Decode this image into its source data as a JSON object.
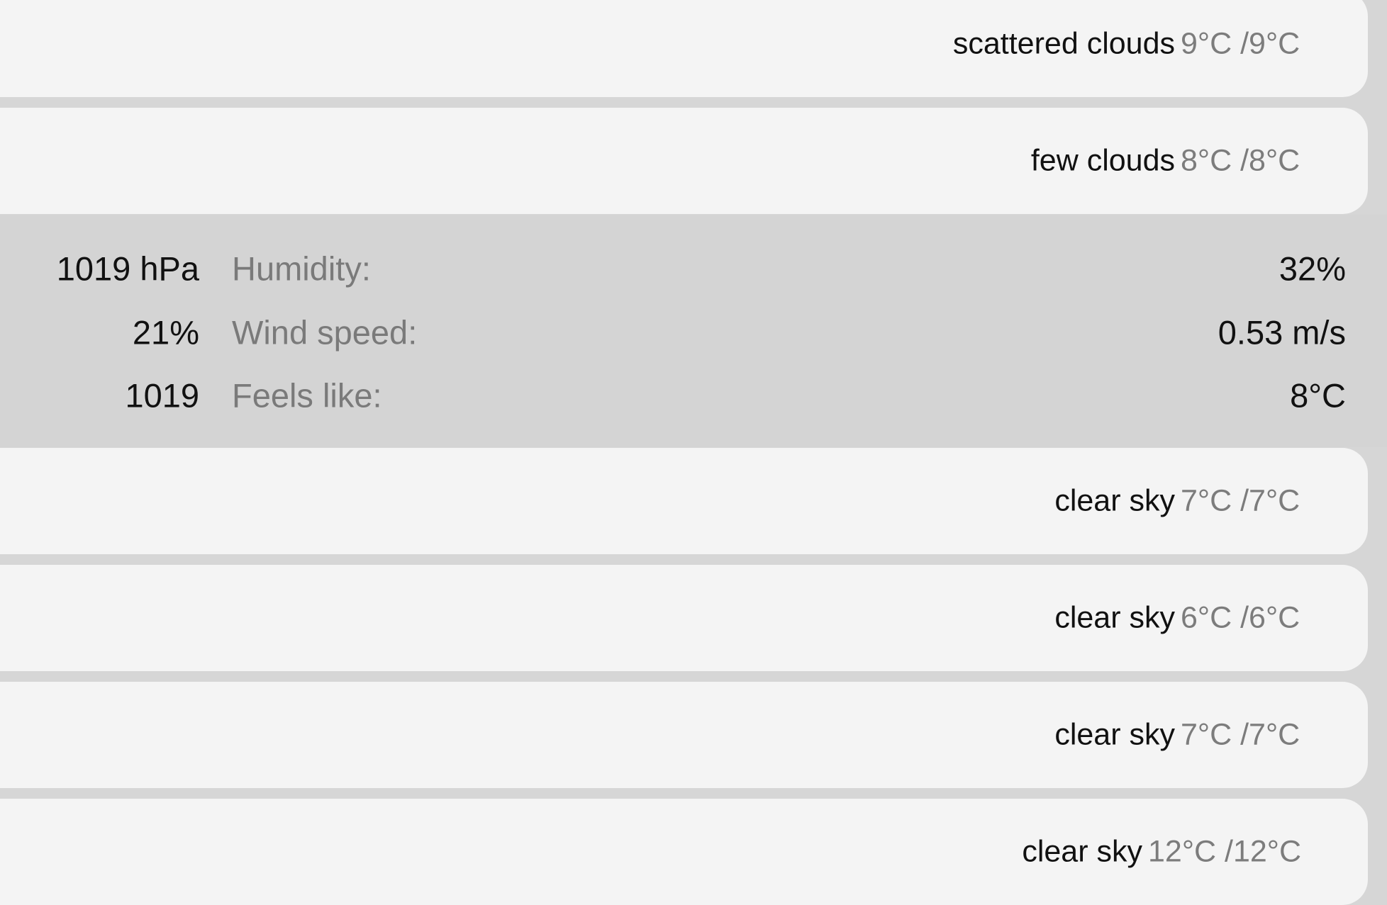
{
  "forecast_rows": [
    {
      "description": "scattered clouds",
      "temp": "9°C /9°C"
    },
    {
      "description": "few clouds",
      "temp": "8°C /8°C"
    },
    {
      "description": "clear sky",
      "temp": "7°C /7°C"
    },
    {
      "description": "clear sky",
      "temp": "6°C /6°C"
    },
    {
      "description": "clear sky",
      "temp": "7°C /7°C"
    },
    {
      "description": "clear sky",
      "temp": "12°C /12°C"
    }
  ],
  "details": [
    {
      "left_value": "1019 hPa",
      "label": "Humidity:",
      "value": "32%"
    },
    {
      "left_value": "21%",
      "label": "Wind speed:",
      "value": "0.53 m/s"
    },
    {
      "left_value": "1019",
      "label": "Feels like:",
      "value": "8°C"
    }
  ]
}
